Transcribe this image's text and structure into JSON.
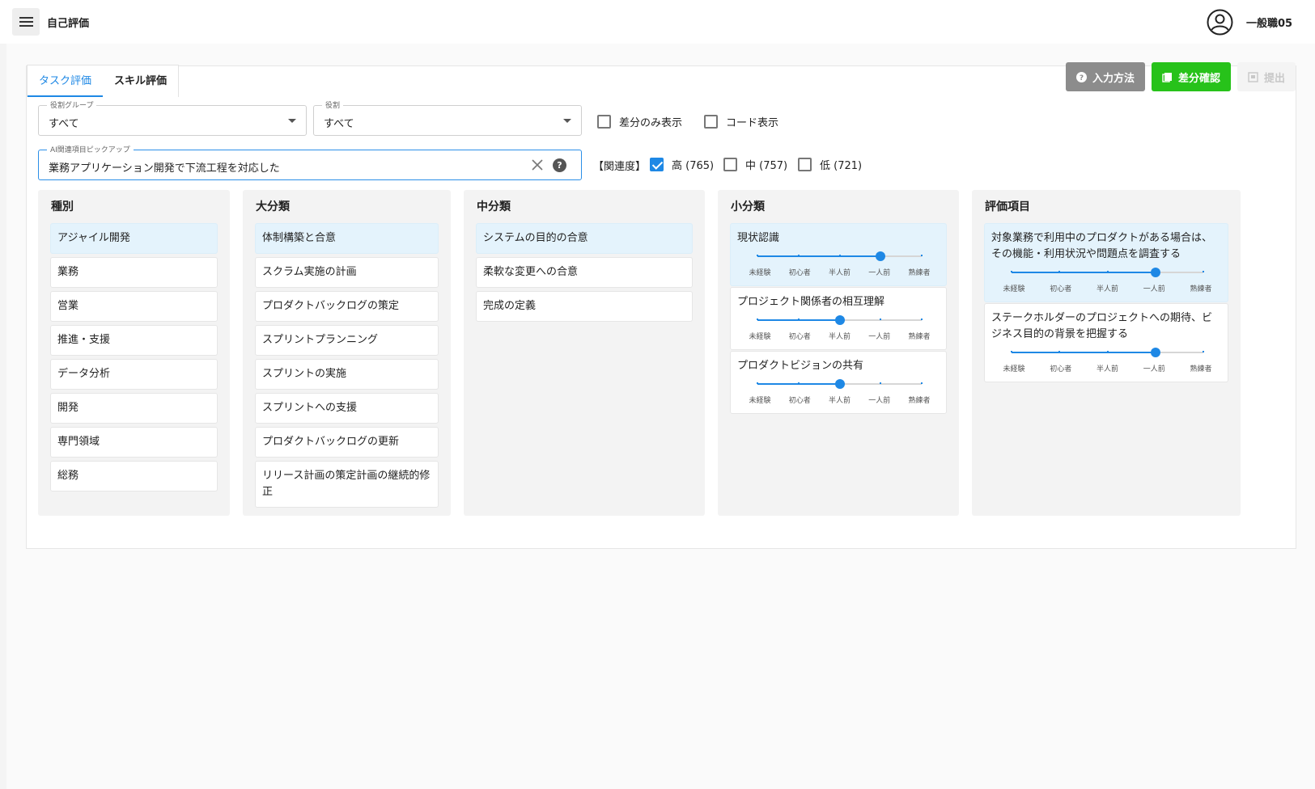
{
  "header": {
    "title": "自己評価",
    "user": "一般職05"
  },
  "tabs": [
    "タスク評価",
    "スキル評価"
  ],
  "actions": {
    "how_to": "入力方法",
    "diff": "差分確認",
    "submit": "提出"
  },
  "filters": {
    "role_group": {
      "label": "役割グループ",
      "value": "すべて"
    },
    "role": {
      "label": "役割",
      "value": "すべて"
    },
    "diff_only": "差分のみ表示",
    "show_code": "コード表示",
    "ai_pickup": {
      "label": "AI関連項目ピックアップ",
      "value": "業務アプリケーション開発で下流工程を対応した"
    },
    "relevance_label": "【関連度】",
    "relevance": [
      {
        "label": "高 (765)",
        "checked": true
      },
      {
        "label": "中 (757)",
        "checked": false
      },
      {
        "label": "低 (721)",
        "checked": false
      }
    ]
  },
  "levels": [
    "未経験",
    "初心者",
    "半人前",
    "一人前",
    "熟練者"
  ],
  "columns": {
    "category": {
      "title": "種別",
      "items": [
        "アジャイル開発",
        "業務",
        "営業",
        "推進・支援",
        "データ分析",
        "開発",
        "専門領域",
        "総務"
      ]
    },
    "major": {
      "title": "大分類",
      "items": [
        "体制構築と合意",
        "スクラム実施の計画",
        "プロダクトバックログの策定",
        "スプリントプランニング",
        "スプリントの実施",
        "スプリントへの支援",
        "プロダクトバックログの更新",
        "リリース計画の策定計画の継続的修正"
      ]
    },
    "middle": {
      "title": "中分類",
      "items": [
        "システムの目的の合意",
        "柔軟な変更への合意",
        "完成の定義"
      ]
    },
    "minor": {
      "title": "小分類",
      "items": [
        {
          "label": "現状認識",
          "level": 3
        },
        {
          "label": "プロジェクト関係者の相互理解",
          "level": 2
        },
        {
          "label": "プロダクトビジョンの共有",
          "level": 2
        }
      ]
    },
    "eval": {
      "title": "評価項目",
      "items": [
        {
          "label": "対象業務で利用中のプロダクトがある場合は、その機能・利用状況や問題点を調査する",
          "level": 3
        },
        {
          "label": "ステークホルダーのプロジェクトへの期待、ビジネス目的の背景を把握する",
          "level": 3
        }
      ]
    }
  }
}
